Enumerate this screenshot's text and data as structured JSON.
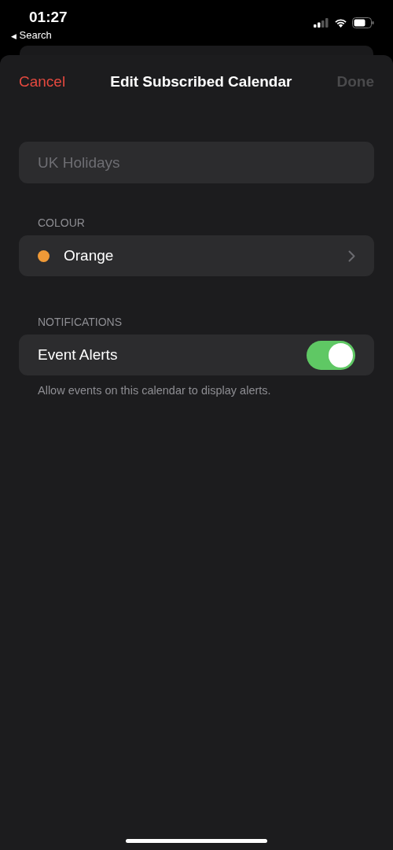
{
  "status_bar": {
    "time": "01:27",
    "back_label": "Search",
    "back_glyph": "◀"
  },
  "nav": {
    "cancel": "Cancel",
    "title": "Edit Subscribed Calendar",
    "done": {
      "label": "Done",
      "disabled": true
    }
  },
  "name_field": {
    "placeholder": "UK Holidays"
  },
  "colour_section": {
    "header": "COLOUR",
    "row": {
      "label": "Orange",
      "color": "#f09a37"
    }
  },
  "notifications_section": {
    "header": "NOTIFICATIONS",
    "row": {
      "label": "Event Alerts",
      "on": true
    },
    "footer": "Allow events on this calendar to display alerts."
  }
}
